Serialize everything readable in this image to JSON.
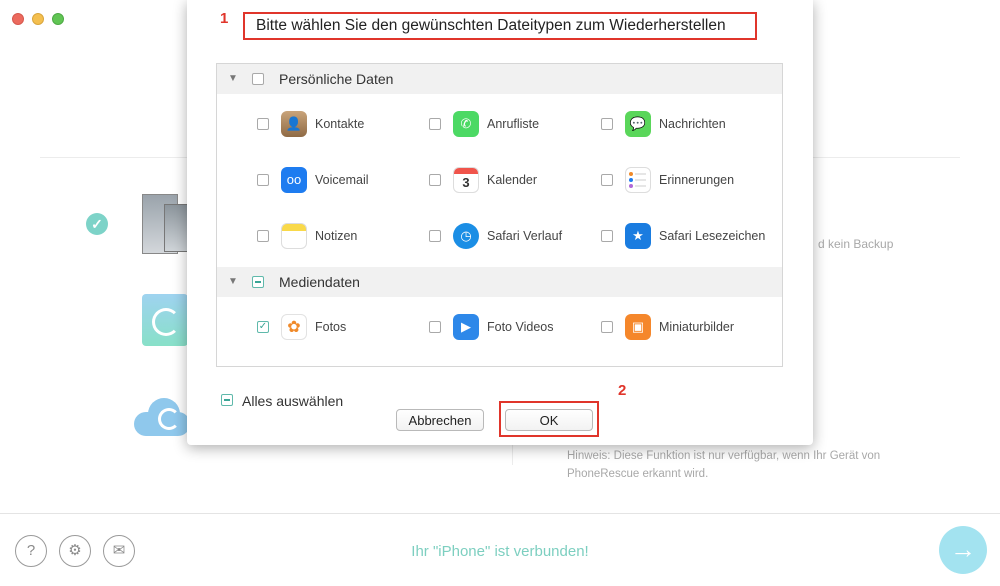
{
  "background": {
    "no_backup_text": "d kein Backup",
    "hint_line1": "Hinweis: Diese Funktion ist nur verfügbar, wenn Ihr Gerät von",
    "hint_line2": "PhoneRescue erkannt wird."
  },
  "footer": {
    "status": "Ihr \"iPhone\" ist verbunden!",
    "help_icon": "?",
    "settings_icon": "⚙",
    "mail_icon": "✉",
    "next_icon": "→"
  },
  "dialog": {
    "marker1": "1",
    "marker2": "2",
    "title": "Bitte wählen Sie den gewünschten Dateitypen zum Wiederherstellen",
    "sections": [
      {
        "label": "Persönliche Daten",
        "state": "unchecked",
        "items": [
          {
            "label": "Kontakte",
            "icon": "contacts-icon",
            "checked": false
          },
          {
            "label": "Anrufliste",
            "icon": "phone-icon",
            "checked": false
          },
          {
            "label": "Nachrichten",
            "icon": "messages-icon",
            "checked": false
          },
          {
            "label": "Voicemail",
            "icon": "voicemail-icon",
            "checked": false
          },
          {
            "label": "Kalender",
            "icon": "calendar-icon",
            "checked": false
          },
          {
            "label": "Erinnerungen",
            "icon": "reminders-icon",
            "checked": false
          },
          {
            "label": "Notizen",
            "icon": "notes-icon",
            "checked": false
          },
          {
            "label": "Safari Verlauf",
            "icon": "safari-history-icon",
            "checked": false
          },
          {
            "label": "Safari Lesezeichen",
            "icon": "safari-bookmarks-icon",
            "checked": false
          }
        ]
      },
      {
        "label": "Mediendaten",
        "state": "mixed",
        "items": [
          {
            "label": "Fotos",
            "icon": "photos-icon",
            "checked": true
          },
          {
            "label": "Foto Videos",
            "icon": "photo-videos-icon",
            "checked": false
          },
          {
            "label": "Miniaturbilder",
            "icon": "thumbnails-icon",
            "checked": false
          }
        ]
      }
    ],
    "calendar_day": "3",
    "select_all_label": "Alles auswählen",
    "cancel_label": "Abbrechen",
    "ok_label": "OK"
  }
}
